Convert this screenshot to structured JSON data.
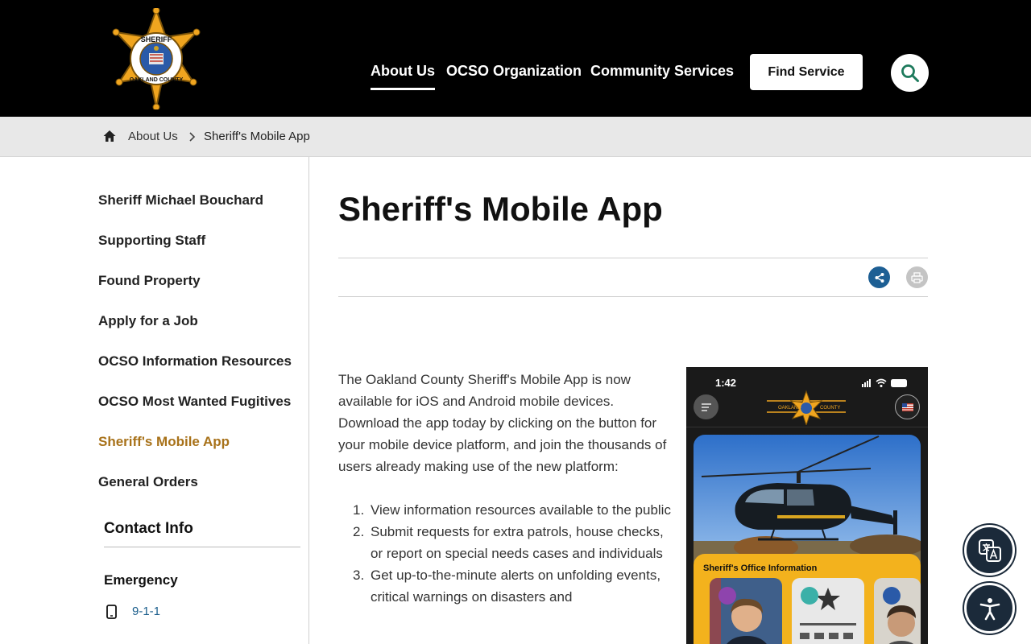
{
  "header": {
    "logo_text_top": "SHERIFF",
    "logo_text_bottom": "OAKLAND COUNTY",
    "nav": [
      "About Us",
      "OCSO Organization",
      "Community Services"
    ],
    "find_service": "Find Service",
    "search_icon": "search-icon",
    "accent_color": "#1d7a5c"
  },
  "breadcrumb": {
    "home_icon": "home-icon",
    "parent": "About Us",
    "current": "Sheriff's Mobile App"
  },
  "sidebar": {
    "items": [
      "Sheriff Michael Bouchard",
      "Supporting Staff",
      "Found Property",
      "Apply for a Job",
      "OCSO Information Resources",
      "OCSO Most Wanted Fugitives",
      "Sheriff's Mobile App",
      "General Orders"
    ],
    "current_color": "#a8721a",
    "contact": {
      "title": "Contact Info",
      "emergency_label": "Emergency",
      "phone_icon": "mobile-phone-icon",
      "phone": "9-1-1"
    }
  },
  "main": {
    "title": "Sheriff's Mobile App",
    "share_icon": "share-icon",
    "print_icon": "print-icon",
    "intro": "The Oakland County Sheriff's Mobile App is now available for iOS and Android mobile devices. Download the app today by clicking on the button for your mobile device platform, and join the thousands of users already making use of the new platform:",
    "list": [
      {
        "num": "1.",
        "text": "View information resources available to the public"
      },
      {
        "num": "2.",
        "text": "Submit requests for extra patrols, house checks, or report on special needs cases and individuals"
      },
      {
        "num": "3.",
        "text": "Get up-to-the-minute alerts on unfolding events, critical warnings on disasters and"
      }
    ]
  },
  "phone_screenshot": {
    "time": "1:42",
    "logo_left": "OAKLAND",
    "logo_right": "COUNTY",
    "card_title": "Sheriff's Office Information",
    "card_color": "#f3b21d"
  },
  "floating": {
    "translate_icon": "translate-icon",
    "accessibility_icon": "accessibility-icon"
  }
}
